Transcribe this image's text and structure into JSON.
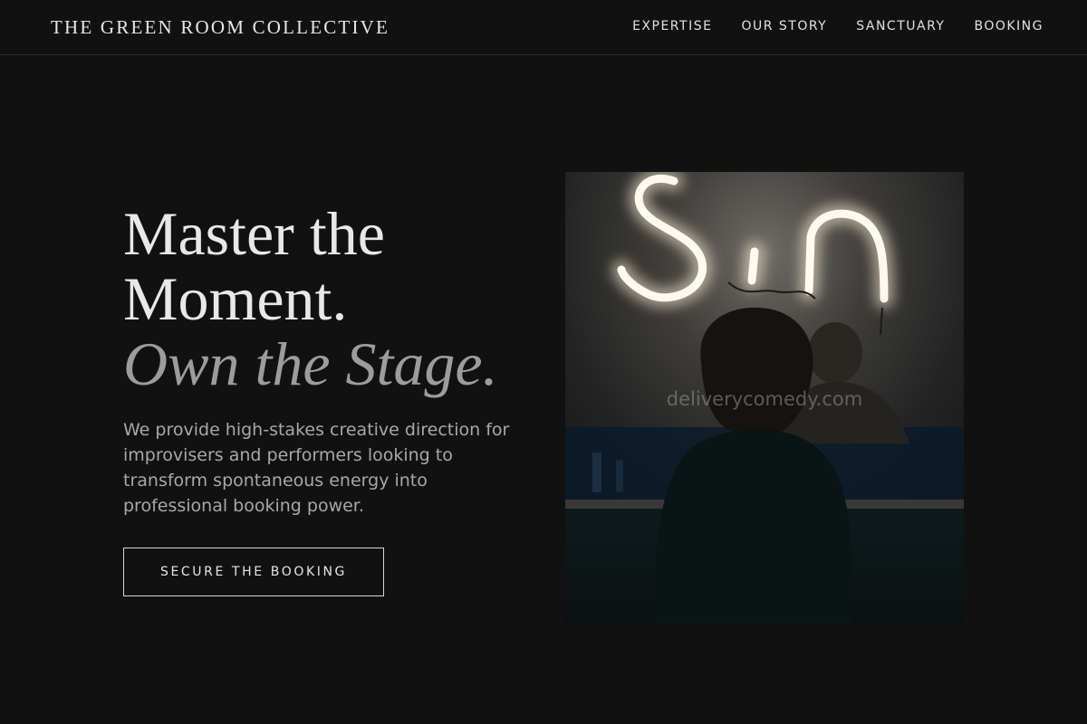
{
  "brand": "THE GREEN ROOM COLLECTIVE",
  "nav": [
    {
      "label": "EXPERTISE"
    },
    {
      "label": "OUR STORY"
    },
    {
      "label": "SANCTUARY"
    },
    {
      "label": "BOOKING"
    }
  ],
  "hero": {
    "title_line1": "Master the",
    "title_line2": "Moment.",
    "title_accent": "Own the Stage.",
    "description": "We provide high-stakes creative direction for improvisers and performers looking to transform spontaneous energy into professional booking power.",
    "cta_label": "SECURE THE BOOKING"
  },
  "photo": {
    "neon_text": "Sin",
    "watermark": "deliverycomedy.com"
  },
  "colors": {
    "background": "#111111",
    "text": "#e8e8e8",
    "muted": "#a8a8a8",
    "accent_italic": "#9c9c9c",
    "neon": "#fff6e4"
  }
}
